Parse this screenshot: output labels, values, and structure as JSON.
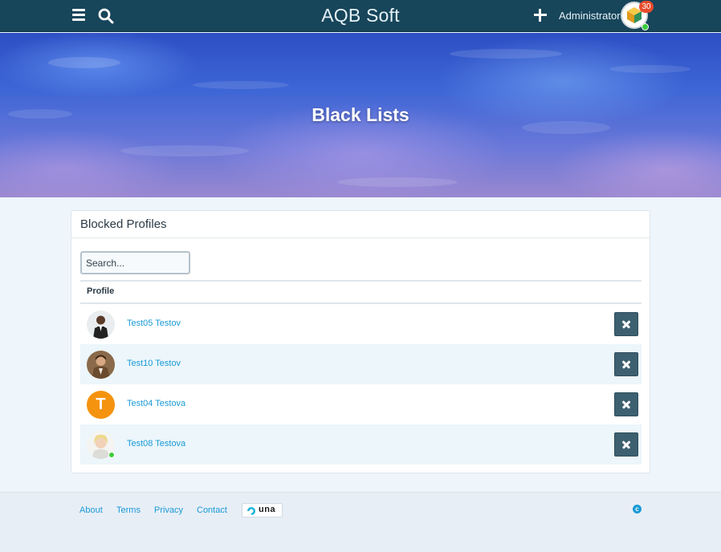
{
  "header": {
    "site_title": "AQB Soft",
    "account_name": "Administrator",
    "notification_count": "30",
    "icons": {
      "menu": "hamburger-icon",
      "search": "search-icon",
      "add": "plus-icon"
    }
  },
  "cover": {
    "title": "Black Lists"
  },
  "blocked": {
    "title": "Blocked Profiles",
    "search_placeholder": "Search...",
    "column_profile": "Profile",
    "rows": [
      {
        "name": "Test05 Testov",
        "avatar": "man-dark-suit",
        "online": false
      },
      {
        "name": "Test10 Testov",
        "avatar": "man-brown-jacket",
        "online": false
      },
      {
        "name": "Test04 Testova",
        "avatar": "letter-T",
        "letter": "T",
        "avatar_color": "#f5930f",
        "online": false
      },
      {
        "name": "Test08 Testova",
        "avatar": "woman-blonde",
        "online": true
      }
    ]
  },
  "footer": {
    "links": [
      "About",
      "Terms",
      "Privacy",
      "Contact"
    ],
    "logo_text": "una"
  },
  "colors": {
    "header_bg": "#17455a",
    "link": "#1a9ad6",
    "delete_button": "#3d6070",
    "row_alt": "#ecf6fb",
    "online": "#3ccc3c",
    "badge": "#e74c2d"
  }
}
